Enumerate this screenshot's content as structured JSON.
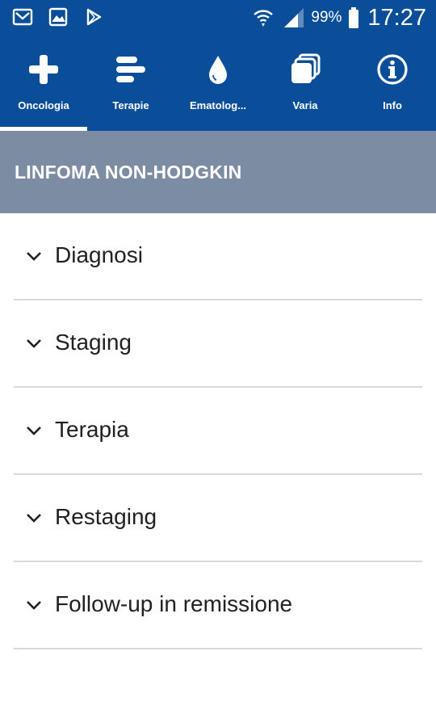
{
  "status_bar": {
    "left_icons": [
      "gmail-icon",
      "gallery-icon",
      "play-store-icon"
    ],
    "battery_percent": "99%",
    "time": "17:27"
  },
  "tabs": [
    {
      "label": "Oncologia",
      "icon": "plus-icon",
      "active": true
    },
    {
      "label": "Terapie",
      "icon": "bars-icon",
      "active": false
    },
    {
      "label": "Ematolog...",
      "icon": "drop-icon",
      "active": false
    },
    {
      "label": "Varia",
      "icon": "stack-icon",
      "active": false
    },
    {
      "label": "Info",
      "icon": "info-icon",
      "active": false
    }
  ],
  "section": {
    "title": "LINFOMA NON-HODGKIN"
  },
  "items": [
    {
      "label": "Diagnosi"
    },
    {
      "label": "Staging"
    },
    {
      "label": "Terapia"
    },
    {
      "label": "Restaging"
    },
    {
      "label": "Follow-up in remissione"
    }
  ],
  "colors": {
    "primary": "#0a4e99",
    "header_gray": "#7c8ca3",
    "divider": "#d9d9d9",
    "text": "#212121"
  }
}
